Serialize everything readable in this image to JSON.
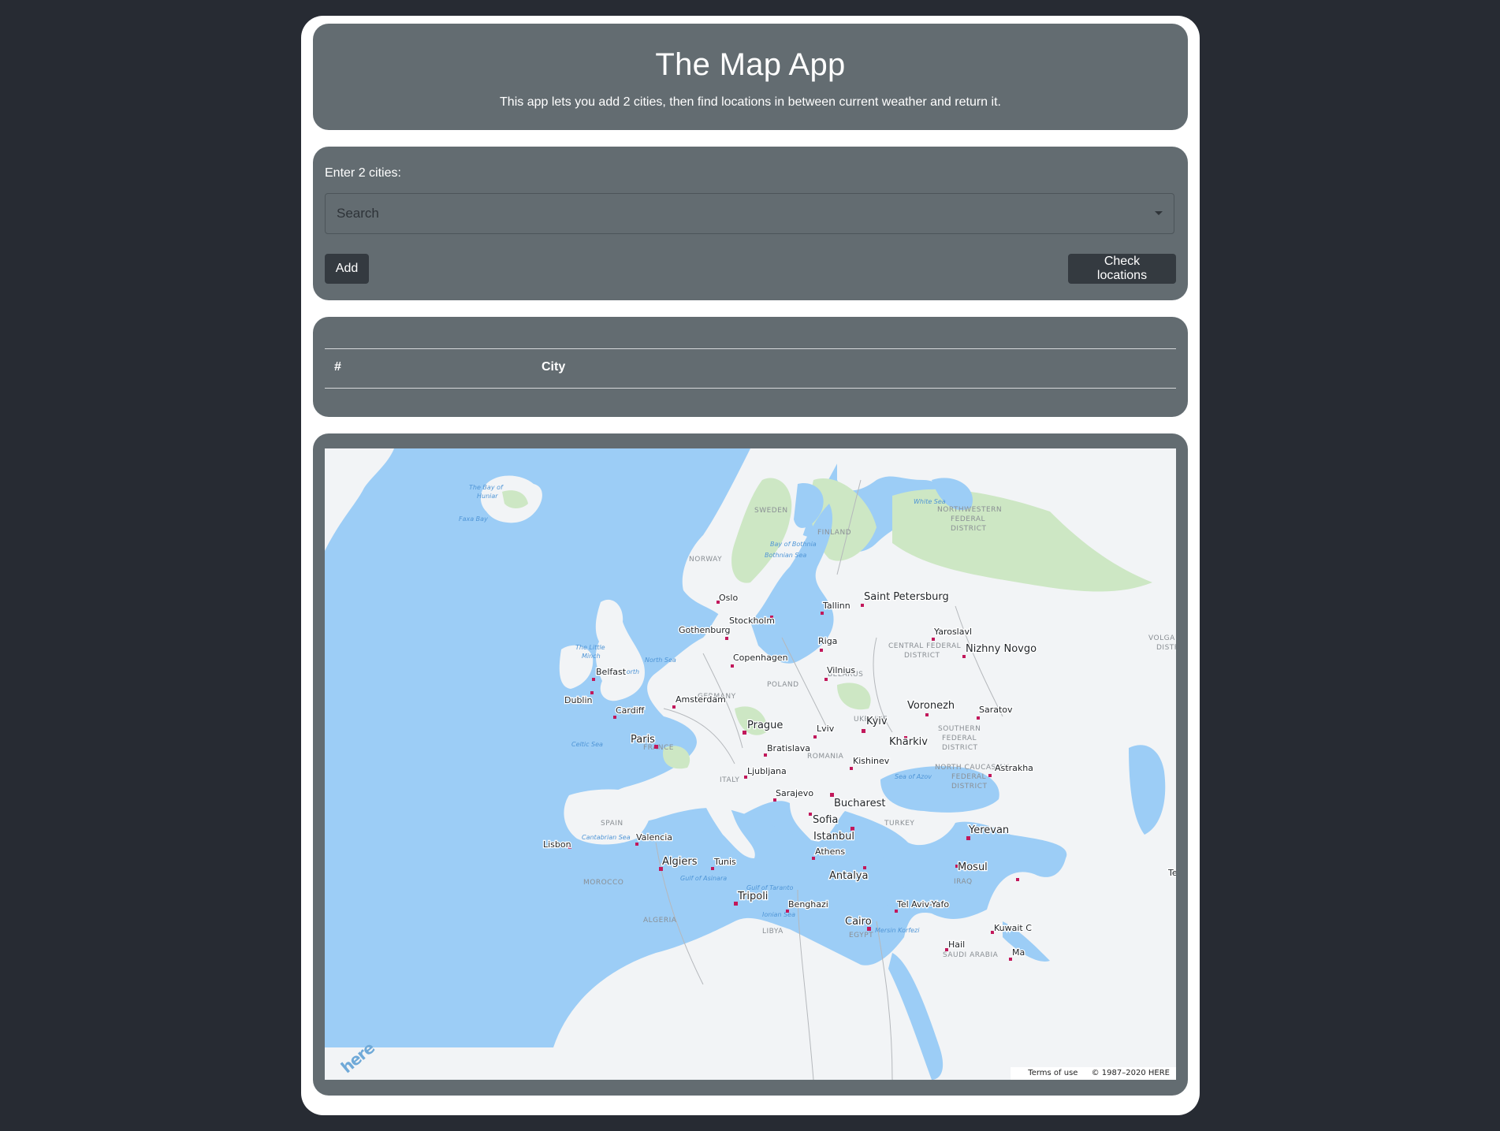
{
  "header": {
    "title": "The Map App",
    "subtitle": "This app lets you add 2 cities, then find locations in between current weather and return it."
  },
  "form": {
    "label": "Enter 2 cities:",
    "search_placeholder": "Search",
    "search_value": "",
    "add_label": "Add",
    "check_label": "Check locations"
  },
  "table": {
    "columns": [
      "#",
      "City"
    ],
    "rows": []
  },
  "map": {
    "water_color": "#9ccdf6",
    "land_color": "#f2f4f6",
    "forest_color": "#cde7c4",
    "city_marker_color": "#c2185b",
    "cities": [
      {
        "name": "Oslo"
      },
      {
        "name": "Stockholm"
      },
      {
        "name": "Tallinn"
      },
      {
        "name": "Saint Petersburg"
      },
      {
        "name": "Gothenburg"
      },
      {
        "name": "Riga"
      },
      {
        "name": "Yaroslavl"
      },
      {
        "name": "Nizhny Novgo"
      },
      {
        "name": "Copenhagen"
      },
      {
        "name": "Vilnius"
      },
      {
        "name": "Belfast"
      },
      {
        "name": "Dublin"
      },
      {
        "name": "Amsterdam"
      },
      {
        "name": "Voronezh"
      },
      {
        "name": "Saratov"
      },
      {
        "name": "Cardiff"
      },
      {
        "name": "Kyiv"
      },
      {
        "name": "Prague"
      },
      {
        "name": "Lviv"
      },
      {
        "name": "Paris"
      },
      {
        "name": "Kharkiv"
      },
      {
        "name": "Bratislava"
      },
      {
        "name": "Kishinev"
      },
      {
        "name": "Ljubljana"
      },
      {
        "name": "Astrakha"
      },
      {
        "name": "Sarajevo"
      },
      {
        "name": "Bucharest"
      },
      {
        "name": "Sofia"
      },
      {
        "name": "Istanbul"
      },
      {
        "name": "Yerevan"
      },
      {
        "name": "Lisbon"
      },
      {
        "name": "Valencia"
      },
      {
        "name": "Athens"
      },
      {
        "name": "Algiers"
      },
      {
        "name": "Tunis"
      },
      {
        "name": "Mosul"
      },
      {
        "name": "Antalya"
      },
      {
        "name": "Te"
      },
      {
        "name": "Tripoli"
      },
      {
        "name": "Benghazi"
      },
      {
        "name": "Tel Aviv-Yafo"
      },
      {
        "name": "Cairo"
      },
      {
        "name": "Kuwait C"
      },
      {
        "name": "Hail"
      },
      {
        "name": "Ma"
      }
    ],
    "regions": [
      "SWEDEN",
      "FINLAND",
      "NORWAY",
      "NORTHWESTERN",
      "FEDERAL",
      "DISTRICT",
      "CENTRAL FEDERAL",
      "DISTRICT",
      "VOLGA FE",
      "DISTRI",
      "BELARUS",
      "POLAND",
      "GERMANY",
      "UKRAINE",
      "SOUTHERN",
      "FEDERAL",
      "DISTRICT",
      "FRANCE",
      "ROMANIA",
      "NORTH CAUCASIAN",
      "FEDERAL",
      "DISTRICT",
      "ITALY",
      "SPAIN",
      "TURKEY",
      "IRAQ",
      "MOROCCO",
      "ALGERIA",
      "LIBYA",
      "EGYPT",
      "SAUDI ARABIA"
    ],
    "seas": [
      "The Bay of",
      "Huniar",
      "Faxa Bay",
      "White Sea",
      "Bay of Bothnia",
      "Bothnian Sea",
      "The Little",
      "Minch",
      "North Sea",
      "Firth of Forth",
      "Celtic Sea",
      "Sea of Azov",
      "Cantabrian Sea",
      "Gulf of Asinara",
      "Gulf of Taranto",
      "Ionian Sea",
      "Mersin Korfezi"
    ],
    "attribution": {
      "logo": "here",
      "terms": "Terms of use",
      "copyright": "© 1987–2020 HERE"
    }
  }
}
